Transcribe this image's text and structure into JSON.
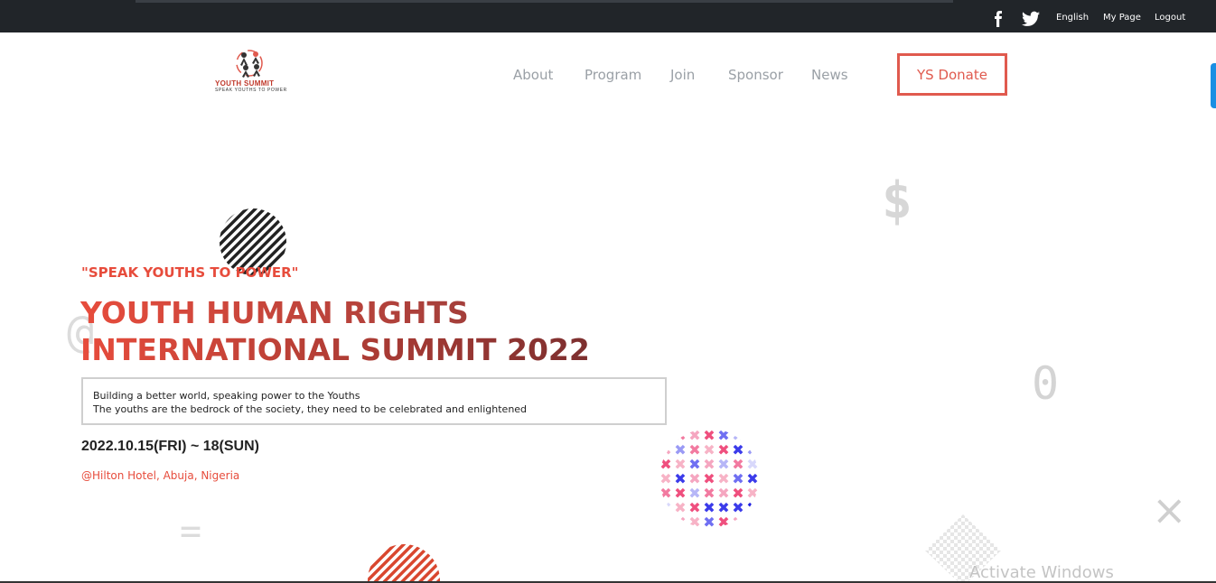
{
  "topbar": {
    "language": "English",
    "my_page": "My Page",
    "logout": "Logout"
  },
  "logo": {
    "title": "YOUTH SUMMIT",
    "subtitle": "SPEAK YOUTHS TO POWER"
  },
  "nav": {
    "items": [
      "About",
      "Program",
      "Join",
      "Sponsor",
      "News"
    ],
    "donate": "YS Donate"
  },
  "hero": {
    "tagline": "\"SPEAK YOUTHS TO POWER\"",
    "title_line1": "YOUTH HUMAN RIGHTS",
    "title_line2": "INTERNATIONAL SUMMIT 2022",
    "desc_line1": "Building a better world, speaking power to the Youths",
    "desc_line2": "The youths are the bedrock of the society, they need to be celebrated and enlightened",
    "date": "2022.10.15(FRI) ~ 18(SUN)",
    "venue": "@Hilton Hotel, Abuja, Nigeria"
  },
  "decorations": {
    "dollar": "$",
    "at": "@",
    "zero": "0",
    "equals": "=",
    "times": "×"
  },
  "watermark": "Activate Windows",
  "colors": {
    "accent": "#e74c3c",
    "topbar": "#212529",
    "nav_text": "#9aa0a6"
  }
}
